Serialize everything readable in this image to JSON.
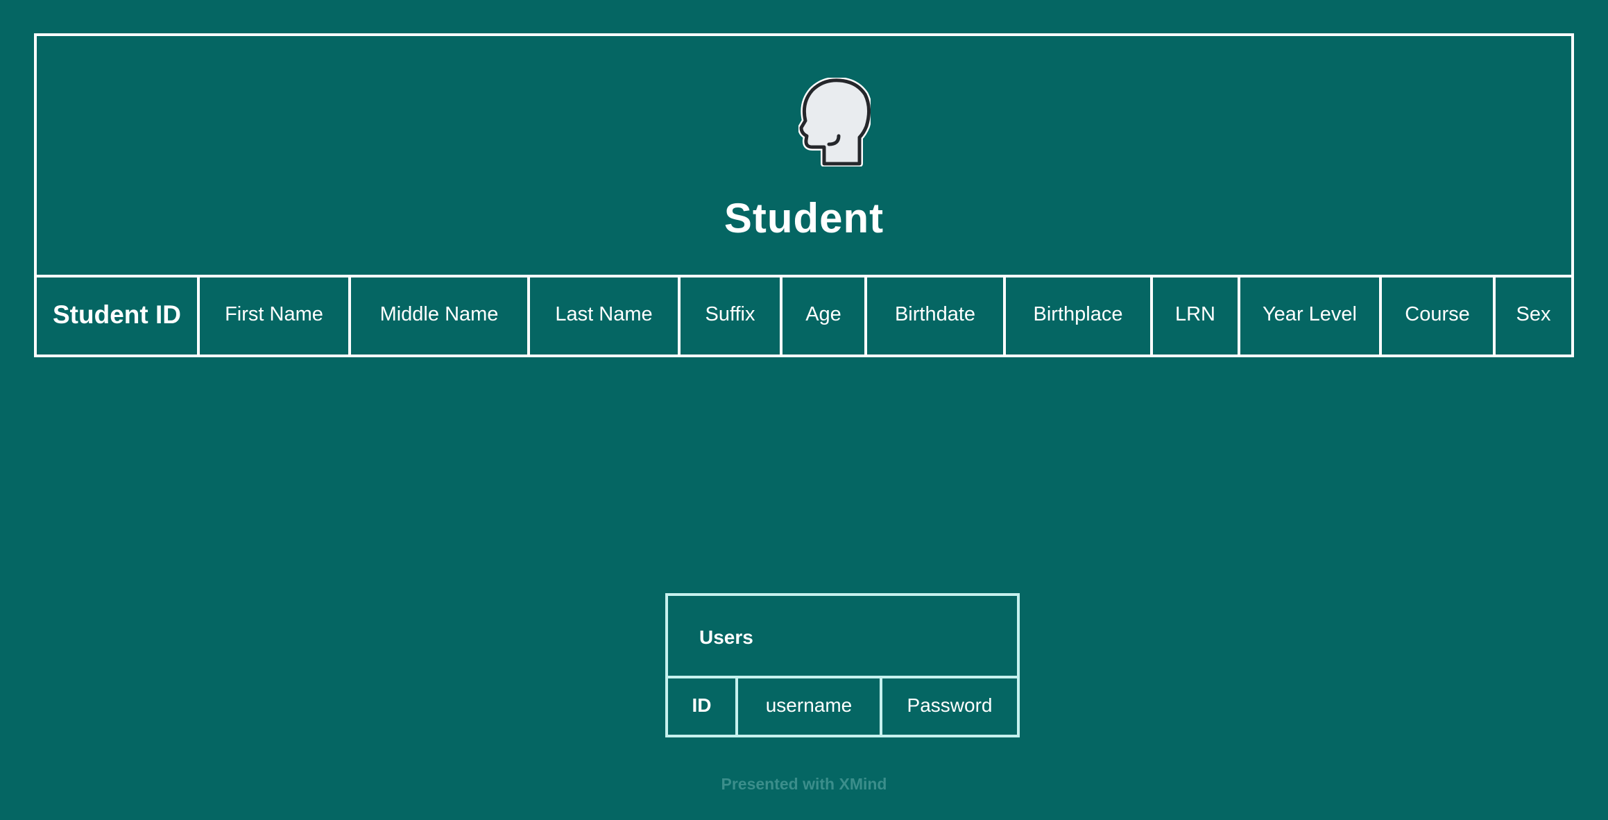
{
  "student": {
    "title": "Student",
    "icon": "head-profile-icon",
    "fields": [
      {
        "label": "Student ID",
        "key": true
      },
      {
        "label": "First Name",
        "key": false
      },
      {
        "label": "Middle Name",
        "key": false
      },
      {
        "label": "Last Name",
        "key": false
      },
      {
        "label": "Suffix",
        "key": false
      },
      {
        "label": "Age",
        "key": false
      },
      {
        "label": "Birthdate",
        "key": false
      },
      {
        "label": "Birthplace",
        "key": false
      },
      {
        "label": "LRN",
        "key": false
      },
      {
        "label": "Year Level",
        "key": false
      },
      {
        "label": "Course",
        "key": false
      },
      {
        "label": "Sex",
        "key": false
      }
    ]
  },
  "users": {
    "title": "Users",
    "fields": [
      {
        "label": "ID",
        "key": true
      },
      {
        "label": "username",
        "key": false
      },
      {
        "label": "Password",
        "key": false
      }
    ]
  },
  "footer": "Presented with XMind",
  "colors": {
    "background": "#056663",
    "student_border": "#ffffff",
    "users_border": "#c7f1ee",
    "footer_text": "#3b8e8b"
  }
}
